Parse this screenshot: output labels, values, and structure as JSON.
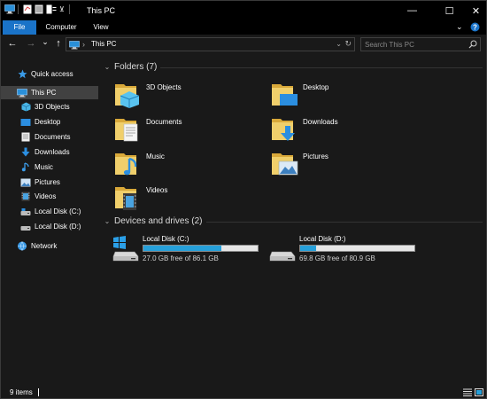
{
  "window": {
    "title": "This PC",
    "minimize": "—",
    "maximize": "☐",
    "close": "✕"
  },
  "ribbon": {
    "tabs": [
      {
        "label": "File",
        "active": true
      },
      {
        "label": "Computer",
        "active": false
      },
      {
        "label": "View",
        "active": false
      }
    ],
    "expand_icon": "chevron-down-icon",
    "help_icon": "help-icon",
    "accent": "#1a73c8"
  },
  "address": {
    "back": "←",
    "forward": "→",
    "recent": "⌄",
    "up": "↑",
    "path": "This PC",
    "separator": "›",
    "dropdown": "⌄",
    "refresh": "↻"
  },
  "search": {
    "placeholder": "Search This PC"
  },
  "sidebar": {
    "items": [
      {
        "label": "Quick access",
        "icon": "star-icon",
        "selected": false
      },
      {
        "label": "This PC",
        "icon": "computer-icon",
        "selected": true
      },
      {
        "label": "3D Objects",
        "icon": "3d-objects-icon",
        "selected": false
      },
      {
        "label": "Desktop",
        "icon": "desktop-icon",
        "selected": false
      },
      {
        "label": "Documents",
        "icon": "documents-icon",
        "selected": false
      },
      {
        "label": "Downloads",
        "icon": "download-icon",
        "selected": false
      },
      {
        "label": "Music",
        "icon": "music-icon",
        "selected": false
      },
      {
        "label": "Pictures",
        "icon": "pictures-icon",
        "selected": false
      },
      {
        "label": "Videos",
        "icon": "videos-icon",
        "selected": false
      },
      {
        "label": "Local Disk (C:)",
        "icon": "drive-icon",
        "selected": false
      },
      {
        "label": "Local Disk (D:)",
        "icon": "drive-icon",
        "selected": false
      },
      {
        "label": "Network",
        "icon": "network-icon",
        "selected": false
      }
    ]
  },
  "folders_group": {
    "header": "Folders (7)",
    "items": [
      {
        "label": "3D Objects",
        "icon": "3d-objects-folder-icon"
      },
      {
        "label": "Desktop",
        "icon": "desktop-folder-icon"
      },
      {
        "label": "Documents",
        "icon": "documents-folder-icon"
      },
      {
        "label": "Downloads",
        "icon": "downloads-folder-icon"
      },
      {
        "label": "Music",
        "icon": "music-folder-icon"
      },
      {
        "label": "Pictures",
        "icon": "pictures-folder-icon"
      },
      {
        "label": "Videos",
        "icon": "videos-folder-icon"
      }
    ]
  },
  "drives_group": {
    "header": "Devices and drives (2)",
    "items": [
      {
        "label": "Local Disk (C:)",
        "free_text": "27.0 GB free of 86.1 GB",
        "used_fraction": 0.686,
        "icon": "windows-drive-icon"
      },
      {
        "label": "Local Disk (D:)",
        "free_text": "69.8 GB free of 80.9 GB",
        "used_fraction": 0.137,
        "icon": "hard-drive-icon"
      }
    ]
  },
  "status": {
    "items_count": "9 items"
  },
  "colors": {
    "folder_yellow": "#e8c25a",
    "drive_fill": "#26a0da",
    "selection": "#414141"
  }
}
